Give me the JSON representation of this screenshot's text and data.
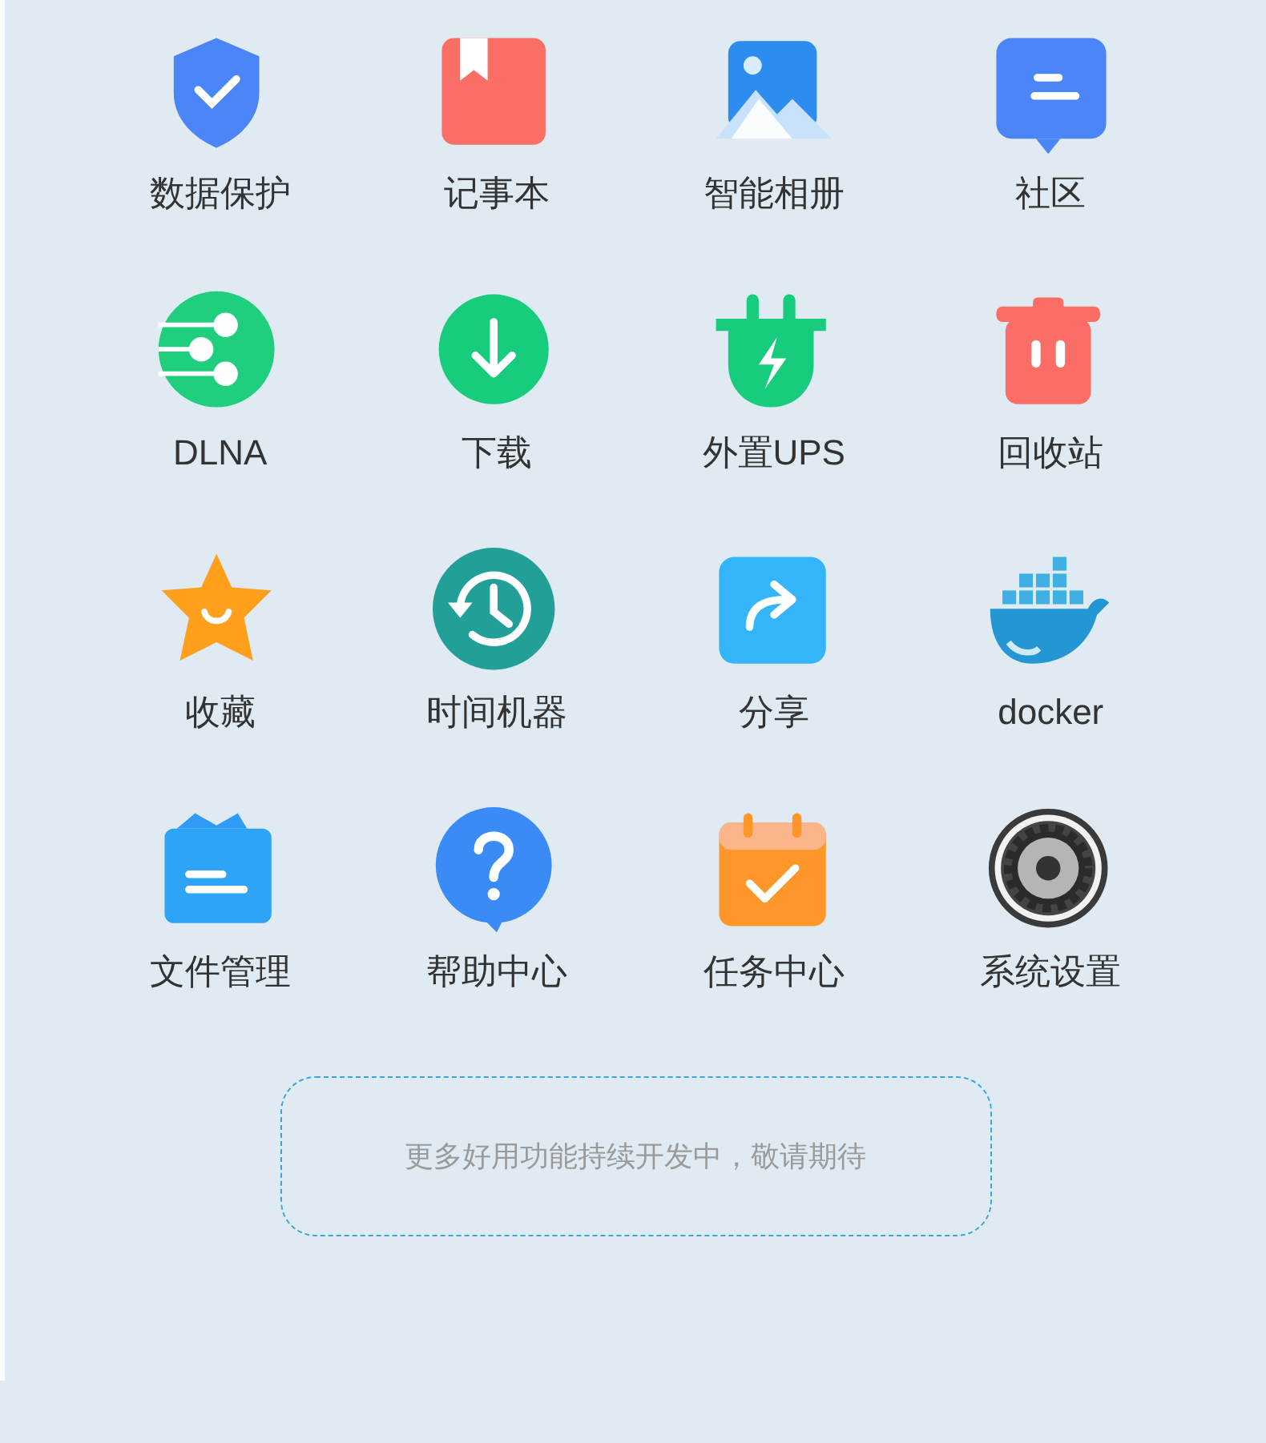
{
  "apps": [
    {
      "label": "数据保护"
    },
    {
      "label": "记事本"
    },
    {
      "label": "智能相册"
    },
    {
      "label": "社区"
    },
    {
      "label": "DLNA"
    },
    {
      "label": "下载"
    },
    {
      "label": "外置UPS"
    },
    {
      "label": "回收站"
    },
    {
      "label": "收藏"
    },
    {
      "label": "时间机器"
    },
    {
      "label": "分享"
    },
    {
      "label": "docker"
    },
    {
      "label": "文件管理"
    },
    {
      "label": "帮助中心"
    },
    {
      "label": "任务中心"
    },
    {
      "label": "系统设置"
    }
  ],
  "notice": {
    "text": "更多好用功能持续开发中，敬请期待"
  }
}
